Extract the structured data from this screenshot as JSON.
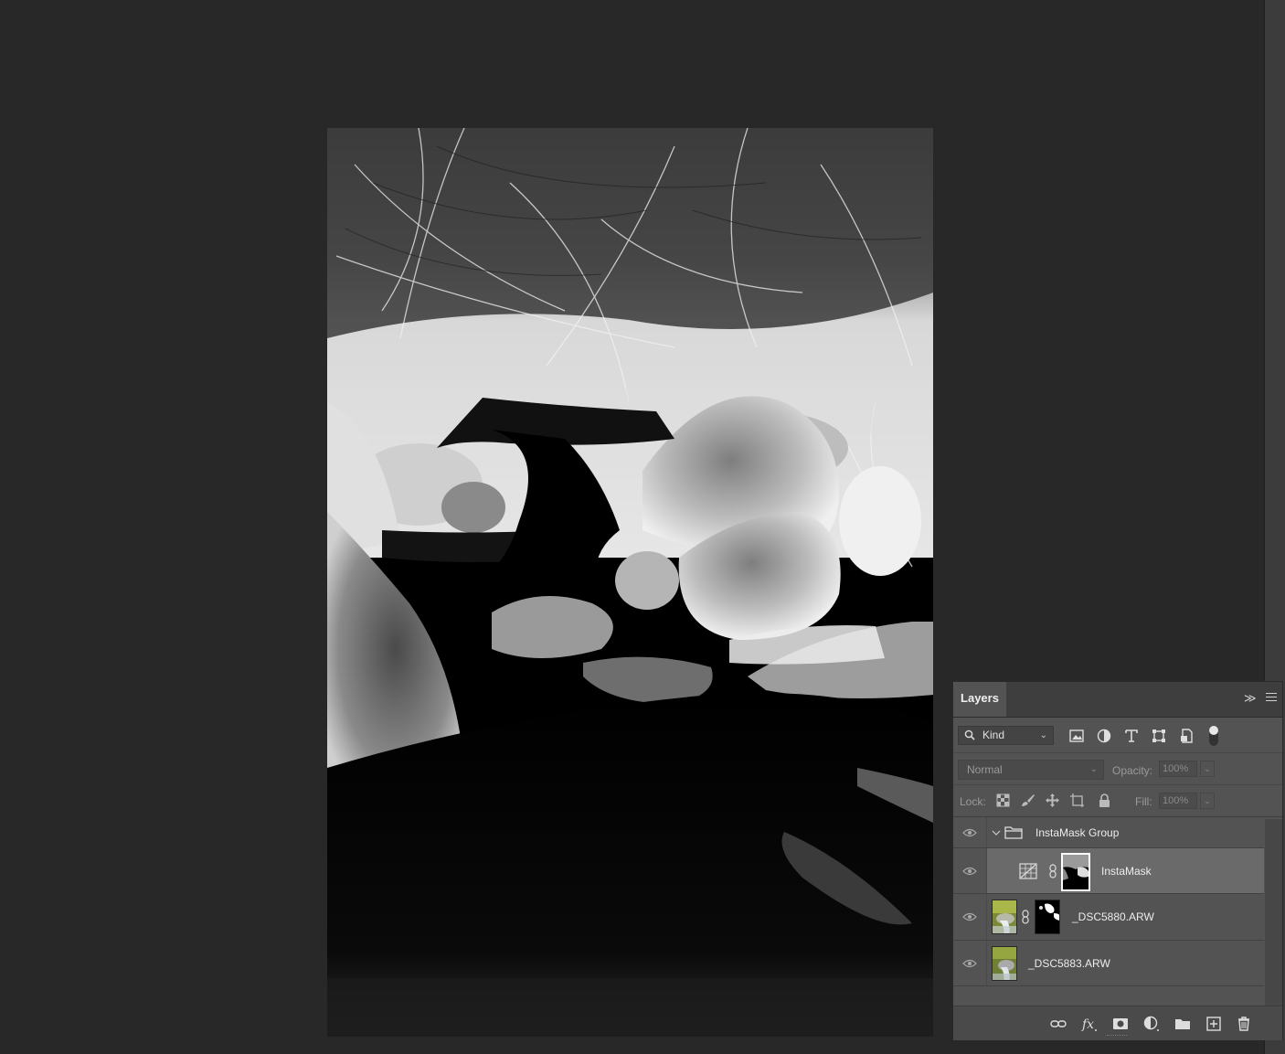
{
  "layers_panel": {
    "tab_label": "Layers",
    "filter": {
      "kind_label": "Kind",
      "icons": [
        "image-filter-icon",
        "adjustment-filter-icon",
        "type-filter-icon",
        "shape-filter-icon",
        "smart-object-filter-icon",
        "filter-toggle"
      ]
    },
    "blend_mode": "Normal",
    "opacity_label": "Opacity:",
    "opacity_value": "100%",
    "lock_label": "Lock:",
    "fill_label": "Fill:",
    "fill_value": "100%",
    "layers": [
      {
        "name": "InstaMask Group",
        "type": "group",
        "expanded": true,
        "visible": true
      },
      {
        "name": "InstaMask",
        "type": "adjustment",
        "selected": true,
        "visible": true
      },
      {
        "name": "_DSC5880.ARW",
        "type": "image-with-mask",
        "visible": true
      },
      {
        "name": "_DSC5883.ARW",
        "type": "image",
        "visible": true
      }
    ],
    "footer_icons": [
      "link-layers-icon",
      "fx-icon",
      "add-mask-icon",
      "adjustment-layer-icon",
      "new-group-icon",
      "new-layer-icon",
      "delete-layer-icon"
    ]
  },
  "colors": {
    "workspace_bg": "#282828",
    "panel_bg": "#535353",
    "panel_header_bg": "#3e3e3e",
    "selected_layer_bg": "#6a6a6a"
  }
}
